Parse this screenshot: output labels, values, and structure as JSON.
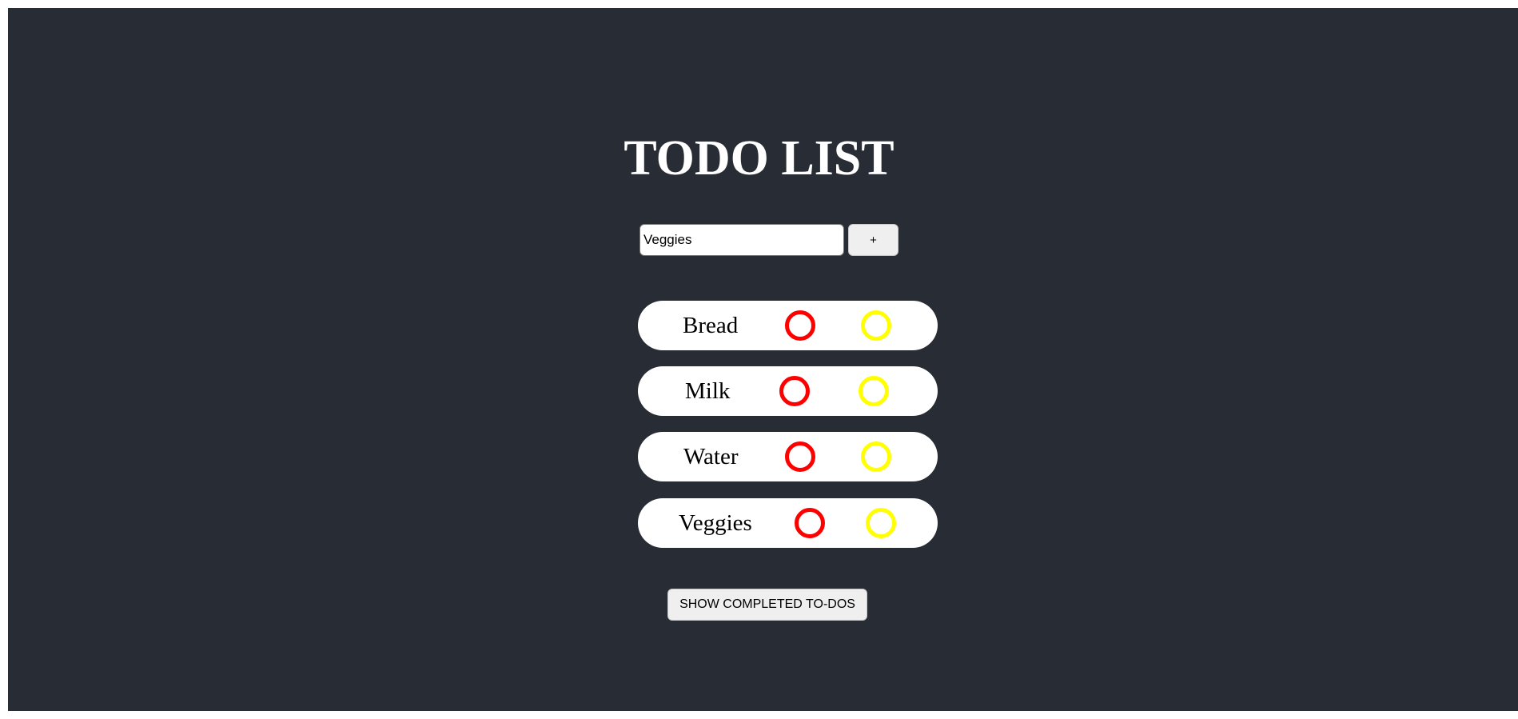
{
  "header": {
    "title": "TODO LIST"
  },
  "new_todo": {
    "value": "Veggies",
    "add_label": "+"
  },
  "todos": [
    {
      "label": "Bread",
      "delete_color": "#ff0000",
      "complete_color": "#ffff00"
    },
    {
      "label": "Milk",
      "delete_color": "#ff0000",
      "complete_color": "#ffff00"
    },
    {
      "label": "Water",
      "delete_color": "#ff0000",
      "complete_color": "#ffff00"
    },
    {
      "label": "Veggies",
      "delete_color": "#ff0000",
      "complete_color": "#ffff00"
    }
  ],
  "footer": {
    "show_completed_label": "SHOW COMPLETED TO-DOS"
  },
  "colors": {
    "background": "#282c34",
    "card": "#ffffff",
    "delete": "#ff0000",
    "complete": "#ffff00"
  }
}
